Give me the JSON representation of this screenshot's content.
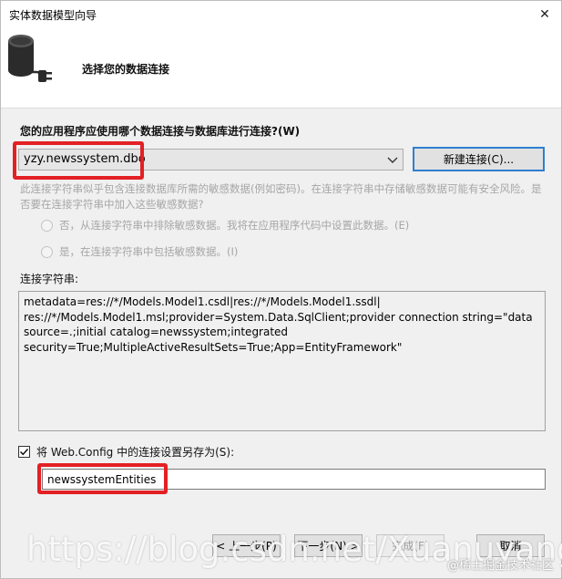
{
  "window": {
    "title": "实体数据模型向导",
    "close_glyph": "✕"
  },
  "header": {
    "title": "选择您的数据连接",
    "icon": "database-plug-icon"
  },
  "question": "您的应用程序应使用哪个数据连接与数据库进行连接?(W)",
  "connection": {
    "selected": "yzy.newssystem.dbo",
    "new_button": "新建连接(C)..."
  },
  "sensitive": {
    "description": "此连接字符串似乎包含连接数据库所需的敏感数据(例如密码)。在连接字符串中存储敏感数据可能有安全风险。是否要在连接字符串中加入这些敏感数据?",
    "option_exclude": "否，从连接字符串中排除敏感数据。我将在应用程序代码中设置此数据。(E)",
    "option_include": "是，在连接字符串中包括敏感数据。(I)"
  },
  "connection_string": {
    "label": "连接字符串:",
    "value": "metadata=res://*/Models.Model1.csdl|res://*/Models.Model1.ssdl|\nres://*/Models.Model1.msl;provider=System.Data.SqlClient;provider connection string=\"data\nsource=.;initial catalog=newssystem;integrated\nsecurity=True;MultipleActiveResultSets=True;App=EntityFramework\""
  },
  "save_setting": {
    "checked": true,
    "label": "将 Web.Config 中的连接设置另存为(S):",
    "value": "newssystemEntities"
  },
  "footer": {
    "prev": "< 上一步(P)",
    "next": "下一步(N) >",
    "finish": "完成(F)",
    "cancel": "取消"
  },
  "watermark": {
    "url": "https://blog.csdn.net/Xuanuyang",
    "badge": "@稀土掘金技术社区"
  },
  "colors": {
    "highlight": "#e32024",
    "accent_border": "#2f7fd0"
  }
}
